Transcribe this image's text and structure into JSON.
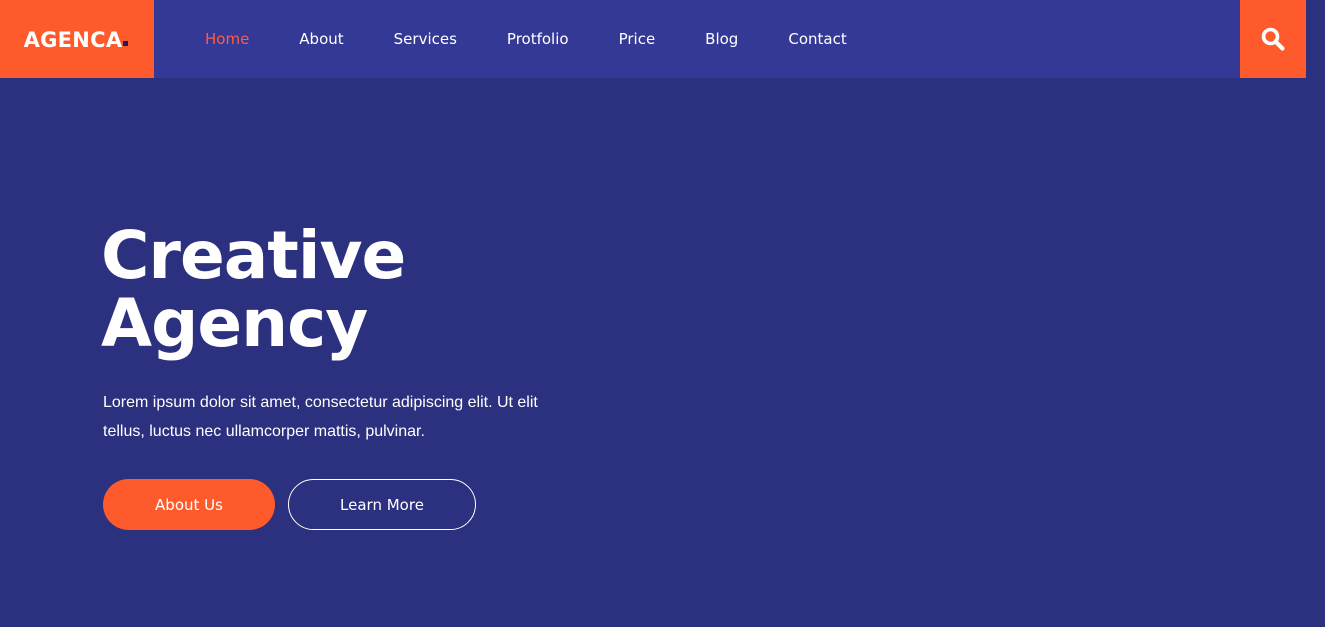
{
  "brand": {
    "name": "AGENCA",
    "accent_color": "#ff5a2c",
    "nav_bg": "#343996",
    "page_bg": "#2b307f"
  },
  "nav": {
    "items": [
      {
        "label": "Home",
        "active": true
      },
      {
        "label": "About",
        "active": false
      },
      {
        "label": "Services",
        "active": false
      },
      {
        "label": "Protfolio",
        "active": false
      },
      {
        "label": "Price",
        "active": false
      },
      {
        "label": "Blog",
        "active": false
      },
      {
        "label": "Contact",
        "active": false
      }
    ],
    "search_icon": "search-icon"
  },
  "hero": {
    "title_line1": "Creative",
    "title_line2": "Agency",
    "description": "Lorem ipsum dolor sit amet, consectetur adipiscing elit. Ut elit tellus, luctus nec ullamcorper mattis, pulvinar.",
    "primary_button": "About Us",
    "secondary_button": "Learn More"
  }
}
